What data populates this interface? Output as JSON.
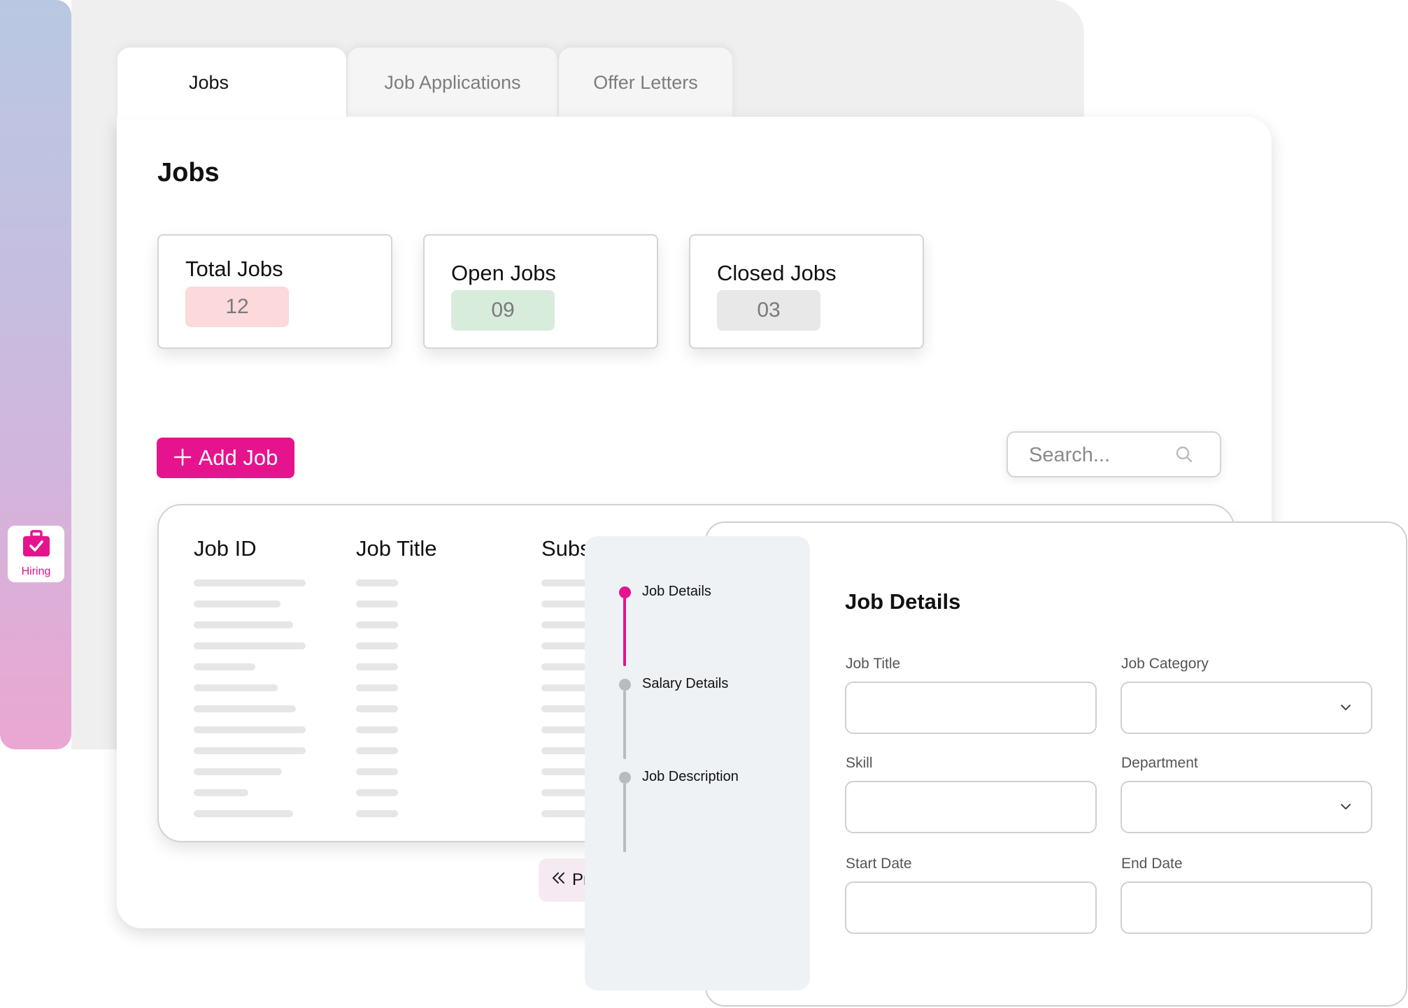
{
  "sidebar": {
    "items": [
      {
        "label": "Hiring",
        "icon": "briefcase-check-icon",
        "active": true
      }
    ]
  },
  "tabs": [
    {
      "label": "Jobs",
      "active": true
    },
    {
      "label": "Job Applications",
      "active": false
    },
    {
      "label": "Offer Letters",
      "active": false
    }
  ],
  "page": {
    "title": "Jobs"
  },
  "stats": [
    {
      "label": "Total Jobs",
      "value": "12",
      "badge_color": "#fcd9db"
    },
    {
      "label": "Open Jobs",
      "value": "09",
      "badge_color": "#d8ecdc"
    },
    {
      "label": "Closed Jobs",
      "value": "03",
      "badge_color": "#e8e8e8"
    }
  ],
  "toolbar": {
    "add_label": "Add Job",
    "add_icon": "plus-icon",
    "search_placeholder": "Search...",
    "search_icon": "search-icon"
  },
  "table": {
    "columns": [
      "Job ID",
      "Job Title",
      "Subs"
    ],
    "row_count": 12
  },
  "pagination": {
    "prev_label": "Pr",
    "prev_icon": "double-chevron-left-icon"
  },
  "stepper": {
    "steps": [
      {
        "label": "Job Details",
        "status": "active"
      },
      {
        "label": "Salary Details",
        "status": "pending"
      },
      {
        "label": "Job Description",
        "status": "pending"
      }
    ]
  },
  "form": {
    "title": "Job Details",
    "fields": [
      {
        "label": "Job Title",
        "type": "text",
        "value": ""
      },
      {
        "label": "Job Category",
        "type": "select",
        "value": ""
      },
      {
        "label": "Skill",
        "type": "text",
        "value": ""
      },
      {
        "label": "Department",
        "type": "select",
        "value": ""
      },
      {
        "label": "Start Date",
        "type": "text",
        "value": ""
      },
      {
        "label": "End Date",
        "type": "text",
        "value": ""
      }
    ]
  },
  "colors": {
    "accent": "#e6138e",
    "step_inactive": "#b9bcbf",
    "text_muted": "#7d7d7d"
  }
}
